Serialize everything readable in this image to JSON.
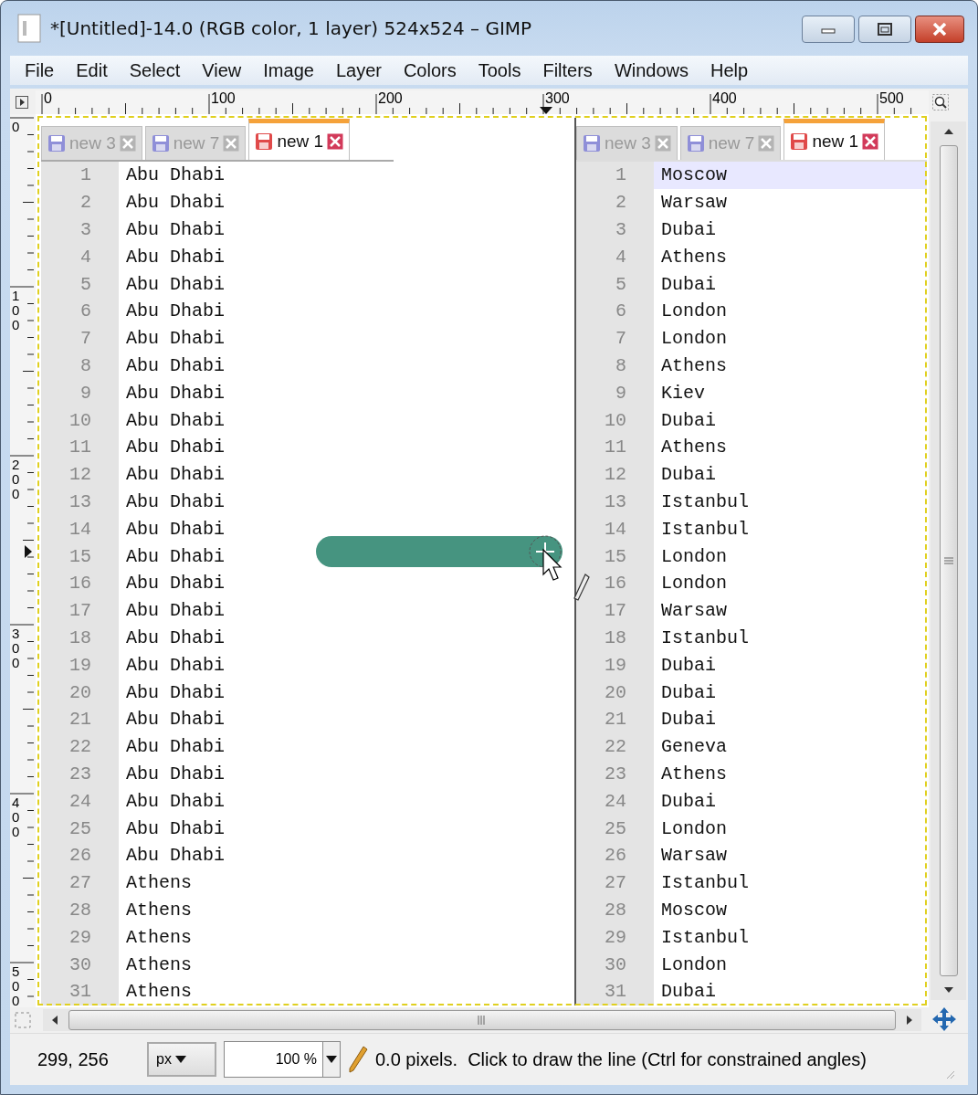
{
  "window": {
    "title": "*[Untitled]-14.0 (RGB color, 1 layer) 524x524 – GIMP"
  },
  "menu": [
    "File",
    "Edit",
    "Select",
    "View",
    "Image",
    "Layer",
    "Colors",
    "Tools",
    "Filters",
    "Windows",
    "Help"
  ],
  "top_ruler": {
    "labels": [
      "0",
      "100",
      "200",
      "300",
      "400",
      "500"
    ]
  },
  "left_ruler": {
    "labels": [
      "0",
      "100",
      "200",
      "300",
      "400",
      "500"
    ]
  },
  "canvas": {
    "panes": [
      {
        "tabs": [
          {
            "label": "new 3",
            "selected": false
          },
          {
            "label": "new 7",
            "selected": false
          },
          {
            "label": "new 1",
            "selected": true
          }
        ],
        "lines": [
          {
            "number": "1",
            "text": "Abu Dhabi",
            "current": false
          },
          {
            "number": "2",
            "text": "Abu Dhabi",
            "current": false
          },
          {
            "number": "3",
            "text": "Abu Dhabi",
            "current": false
          },
          {
            "number": "4",
            "text": "Abu Dhabi",
            "current": false
          },
          {
            "number": "5",
            "text": "Abu Dhabi",
            "current": false
          },
          {
            "number": "6",
            "text": "Abu Dhabi",
            "current": false
          },
          {
            "number": "7",
            "text": "Abu Dhabi",
            "current": false
          },
          {
            "number": "8",
            "text": "Abu Dhabi",
            "current": false
          },
          {
            "number": "9",
            "text": "Abu Dhabi",
            "current": false
          },
          {
            "number": "10",
            "text": "Abu Dhabi",
            "current": false
          },
          {
            "number": "11",
            "text": "Abu Dhabi",
            "current": false
          },
          {
            "number": "12",
            "text": "Abu Dhabi",
            "current": false
          },
          {
            "number": "13",
            "text": "Abu Dhabi",
            "current": false
          },
          {
            "number": "14",
            "text": "Abu Dhabi",
            "current": false
          },
          {
            "number": "15",
            "text": "Abu Dhabi",
            "current": false
          },
          {
            "number": "16",
            "text": "Abu Dhabi",
            "current": false
          },
          {
            "number": "17",
            "text": "Abu Dhabi",
            "current": false
          },
          {
            "number": "18",
            "text": "Abu Dhabi",
            "current": false
          },
          {
            "number": "19",
            "text": "Abu Dhabi",
            "current": false
          },
          {
            "number": "20",
            "text": "Abu Dhabi",
            "current": false
          },
          {
            "number": "21",
            "text": "Abu Dhabi",
            "current": false
          },
          {
            "number": "22",
            "text": "Abu Dhabi",
            "current": false
          },
          {
            "number": "23",
            "text": "Abu Dhabi",
            "current": false
          },
          {
            "number": "24",
            "text": "Abu Dhabi",
            "current": false
          },
          {
            "number": "25",
            "text": "Abu Dhabi",
            "current": false
          },
          {
            "number": "26",
            "text": "Abu Dhabi",
            "current": false
          },
          {
            "number": "27",
            "text": "Athens",
            "current": false
          },
          {
            "number": "28",
            "text": "Athens",
            "current": false
          },
          {
            "number": "29",
            "text": "Athens",
            "current": false
          },
          {
            "number": "30",
            "text": "Athens",
            "current": false
          },
          {
            "number": "31",
            "text": "Athens",
            "current": false
          }
        ]
      },
      {
        "tabs": [
          {
            "label": "new 3",
            "selected": false
          },
          {
            "label": "new 7",
            "selected": false
          },
          {
            "label": "new 1",
            "selected": true
          }
        ],
        "lines": [
          {
            "number": "1",
            "text": "Moscow",
            "current": true
          },
          {
            "number": "2",
            "text": "Warsaw",
            "current": false
          },
          {
            "number": "3",
            "text": "Dubai",
            "current": false
          },
          {
            "number": "4",
            "text": "Athens",
            "current": false
          },
          {
            "number": "5",
            "text": "Dubai",
            "current": false
          },
          {
            "number": "6",
            "text": "London",
            "current": false
          },
          {
            "number": "7",
            "text": "London",
            "current": false
          },
          {
            "number": "8",
            "text": "Athens",
            "current": false
          },
          {
            "number": "9",
            "text": "Kiev",
            "current": false
          },
          {
            "number": "10",
            "text": "Dubai",
            "current": false
          },
          {
            "number": "11",
            "text": "Athens",
            "current": false
          },
          {
            "number": "12",
            "text": "Dubai",
            "current": false
          },
          {
            "number": "13",
            "text": "Istanbul",
            "current": false
          },
          {
            "number": "14",
            "text": "Istanbul",
            "current": false
          },
          {
            "number": "15",
            "text": "London",
            "current": false
          },
          {
            "number": "16",
            "text": "London",
            "current": false
          },
          {
            "number": "17",
            "text": "Warsaw",
            "current": false
          },
          {
            "number": "18",
            "text": "Istanbul",
            "current": false
          },
          {
            "number": "19",
            "text": "Dubai",
            "current": false
          },
          {
            "number": "20",
            "text": "Dubai",
            "current": false
          },
          {
            "number": "21",
            "text": "Dubai",
            "current": false
          },
          {
            "number": "22",
            "text": "Geneva",
            "current": false
          },
          {
            "number": "23",
            "text": "Athens",
            "current": false
          },
          {
            "number": "24",
            "text": "Dubai",
            "current": false
          },
          {
            "number": "25",
            "text": "London",
            "current": false
          },
          {
            "number": "26",
            "text": "Warsaw",
            "current": false
          },
          {
            "number": "27",
            "text": "Istanbul",
            "current": false
          },
          {
            "number": "28",
            "text": "Moscow",
            "current": false
          },
          {
            "number": "29",
            "text": "Istanbul",
            "current": false
          },
          {
            "number": "30",
            "text": "London",
            "current": false
          },
          {
            "number": "31",
            "text": "Dubai",
            "current": false
          }
        ]
      }
    ]
  },
  "status_bar": {
    "coordinates": "299, 256",
    "unit": "px",
    "zoom": "100 %",
    "message": "0.0 pixels.  Click to draw the line (Ctrl for constrained angles)"
  }
}
